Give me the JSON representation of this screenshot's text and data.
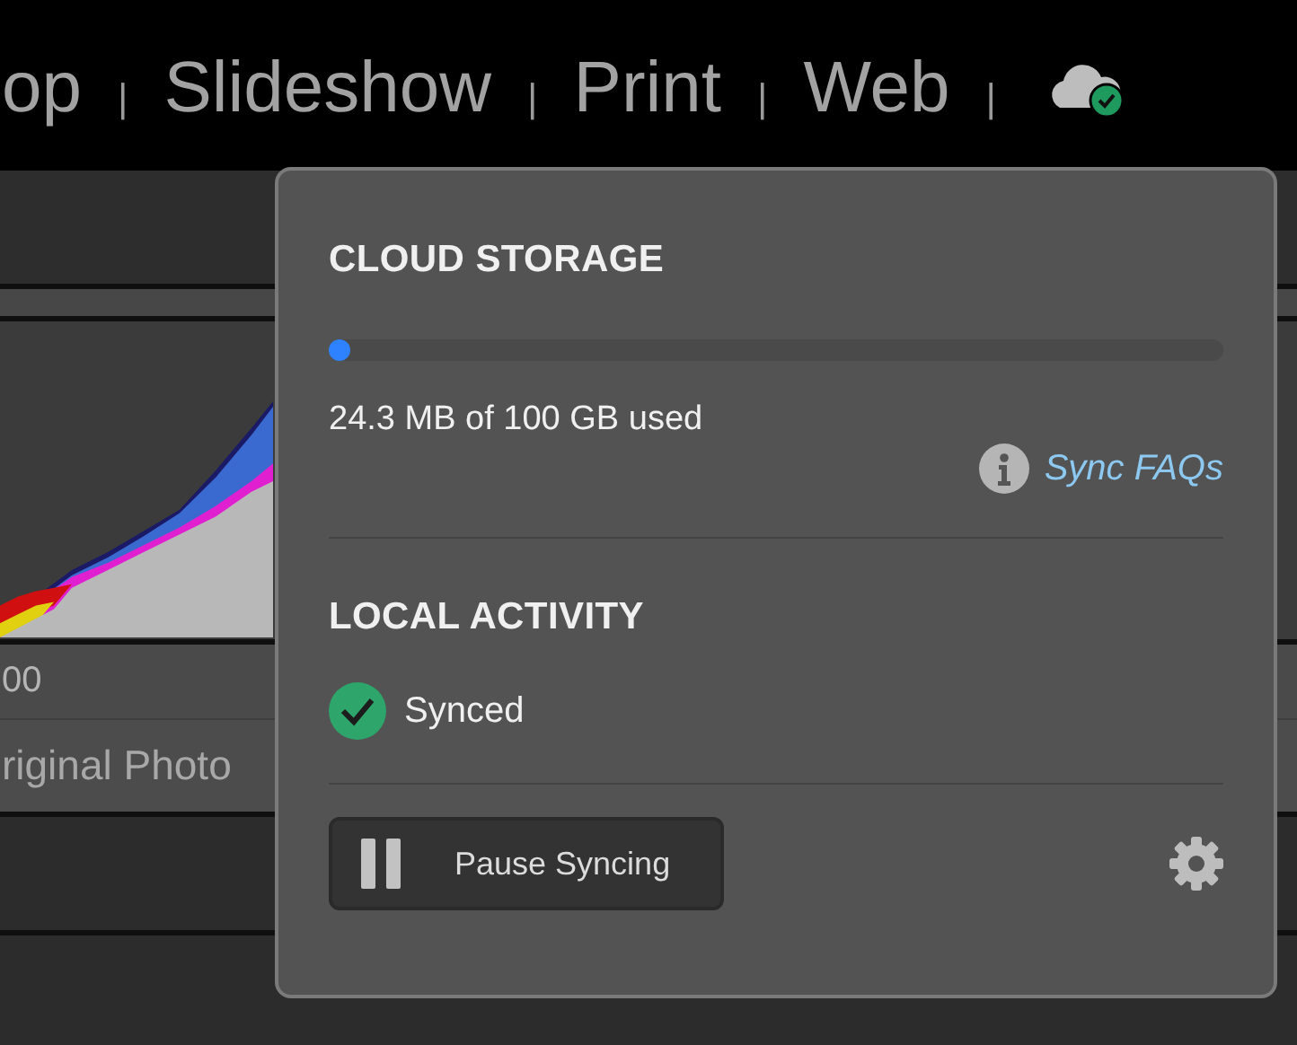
{
  "module_bar": {
    "items": [
      {
        "label": "op",
        "selected": false
      },
      {
        "label": "Slideshow",
        "selected": false
      },
      {
        "label": "Print",
        "selected": false
      },
      {
        "label": "Web",
        "selected": false
      }
    ],
    "separator": "|"
  },
  "background_panel": {
    "histogram_labels": [
      "00"
    ],
    "photo_label": "riginal Photo"
  },
  "cloud_popup": {
    "storage_title": "CLOUD STORAGE",
    "storage": {
      "level": 0.005,
      "reading": "24.3 MB of 100 GB used"
    },
    "faq_link": "Sync FAQs",
    "activity_title": "LOCAL ACTIVITY",
    "activity": {
      "label": "Synced"
    },
    "pause_button": "Pause Syncing"
  }
}
